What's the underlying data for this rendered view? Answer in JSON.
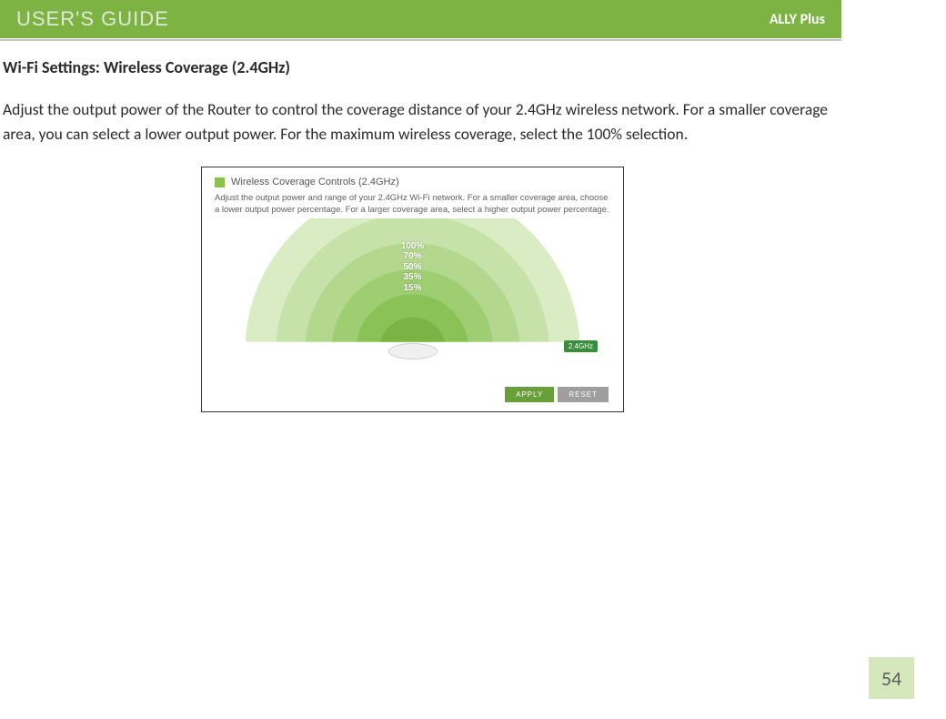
{
  "header": {
    "left": "USER'S GUIDE",
    "right": "ALLY Plus"
  },
  "section": {
    "title": "Wi-Fi Settings: Wireless Coverage (2.4GHz)",
    "body": "Adjust the output power of the Router to control the coverage distance of your 2.4GHz wireless network.  For a smaller coverage area, you can select a lower output power.  For the maximum wireless coverage, select the 100% selection."
  },
  "panel": {
    "title": "Wireless Coverage Controls (2.4GHz)",
    "description": "Adjust the output power and range of your 2.4GHz Wi-Fi network. For a smaller coverage area, choose a lower output power percentage. For a larger coverage area, select a higher output power percentage.",
    "levels": [
      "100%",
      "70%",
      "50%",
      "35%",
      "15%"
    ],
    "band_badge": "2.4GHz",
    "apply": "APPLY",
    "reset": "RESET"
  },
  "page_number": "54",
  "colors": {
    "accent": "#7cb342"
  }
}
